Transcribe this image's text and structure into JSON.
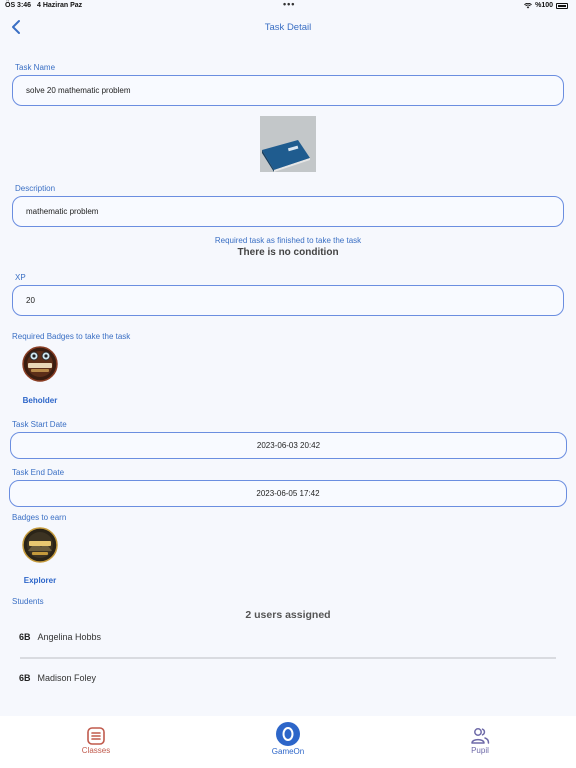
{
  "status_bar": {
    "time": "ÖS 3:46",
    "date": "4 Haziran Paz",
    "battery": "%100"
  },
  "header": {
    "title": "Task Detail"
  },
  "task_name": {
    "label": "Task Name",
    "value": "solve 20 mathematic problem"
  },
  "description": {
    "label": "Description",
    "value": "mathematic problem"
  },
  "requirement": {
    "note": "Required task as finished to take the task",
    "value": "There is no condition"
  },
  "xp": {
    "label": "XP",
    "value": "20"
  },
  "required_badges": {
    "label": "Required Badges to take the task",
    "items": [
      {
        "name": "Beholder"
      }
    ]
  },
  "start_date": {
    "label": "Task Start Date",
    "value": "2023-06-03 20:42"
  },
  "end_date": {
    "label": "Task End Date",
    "value": "2023-06-05 17:42"
  },
  "earn_badges": {
    "label": "Badges to earn",
    "items": [
      {
        "name": "Explorer"
      }
    ]
  },
  "students": {
    "label": "Students",
    "assigned": "2 users assigned",
    "list": [
      {
        "class": "6B",
        "name": "Angelina  Hobbs"
      },
      {
        "class": "6B",
        "name": "Madison  Foley"
      }
    ]
  },
  "tab_bar": {
    "tabs": [
      {
        "label": "Classes"
      },
      {
        "label": "GameOn"
      },
      {
        "label": "Pupil"
      }
    ]
  },
  "colors": {
    "accent": "#3a6fc4",
    "classes_tab": "#c05a4c",
    "gameon_tab": "#2d66c9",
    "pupil_tab": "#6e6aa8"
  }
}
